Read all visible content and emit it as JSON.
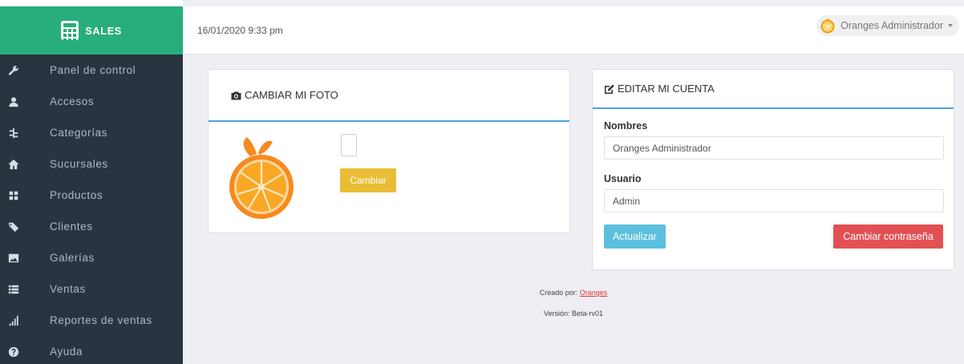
{
  "brand": {
    "name": "SALES",
    "icon": "calculator-icon"
  },
  "sidebar": {
    "items": [
      {
        "label": "Panel de control",
        "icon": "wrench-icon"
      },
      {
        "label": "Accesos",
        "icon": "user-icon"
      },
      {
        "label": "Categorías",
        "icon": "sitemap-icon"
      },
      {
        "label": "Sucursales",
        "icon": "home-icon"
      },
      {
        "label": "Productos",
        "icon": "th-large-icon"
      },
      {
        "label": "Clientes",
        "icon": "tags-icon"
      },
      {
        "label": "Galerías",
        "icon": "picture-icon"
      },
      {
        "label": "Ventas",
        "icon": "list-icon"
      },
      {
        "label": "Reportes de ventas",
        "icon": "signal-icon"
      },
      {
        "label": "Ayuda",
        "icon": "question-icon"
      }
    ]
  },
  "header": {
    "datetime": "16/01/2020 9:33 pm",
    "user_name": "Oranges Administrador"
  },
  "photo_panel": {
    "title": "CAMBIAR MI FOTO",
    "submit_label": "Cambiar"
  },
  "account_panel": {
    "title": "EDITAR MI CUENTA",
    "nombres_label": "Nombres",
    "nombres_value": "Oranges Administrador",
    "usuario_label": "Usuario",
    "usuario_value": "Admin",
    "update_label": "Actualizar",
    "change_password_label": "Cambiar contraseña"
  },
  "footer": {
    "created_by_prefix": "Creado por:",
    "created_by_link": "Oranges",
    "version": "Versión: Beta-rv01"
  },
  "colors": {
    "brand": "#27ae7a",
    "sidebar": "#283541",
    "accent_line": "#4da3db",
    "warning": "#e9bd35",
    "info": "#5bc0de",
    "danger": "#e35054"
  }
}
